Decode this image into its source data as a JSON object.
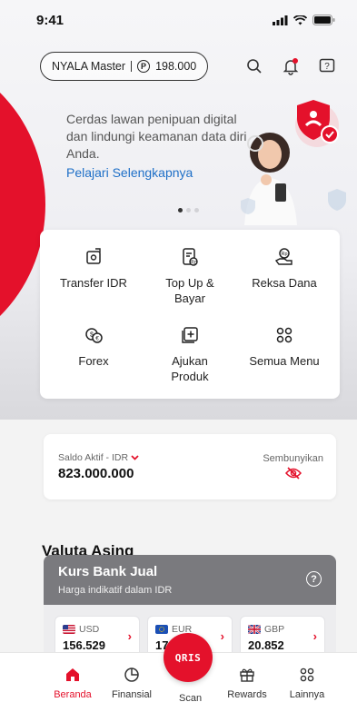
{
  "status_bar": {
    "time": "9:41"
  },
  "header": {
    "account_name": "NYALA Master",
    "points_symbol": "P",
    "points_value": "198.000"
  },
  "promo": {
    "text": "Cerdas lawan penipuan digital dan lindungi keamanan data diri Anda.",
    "link": "Pelajari Selengkapnya",
    "page_count": 3,
    "active_page": 1
  },
  "menu": {
    "items": [
      {
        "label": "Transfer IDR",
        "icon": "transfer-icon"
      },
      {
        "label": "Top Up &\nBayar",
        "icon": "topup-icon"
      },
      {
        "label": "Reksa Dana",
        "icon": "mutual-fund-icon"
      },
      {
        "label": "Forex",
        "icon": "forex-icon"
      },
      {
        "label": "Ajukan\nProduk",
        "icon": "apply-product-icon"
      },
      {
        "label": "Semua Menu",
        "icon": "all-menu-icon"
      }
    ]
  },
  "balance": {
    "label": "Saldo Aktif - IDR",
    "value": "823.000.000",
    "hide_label": "Sembunyikan"
  },
  "valuta": {
    "title": "Valuta Asing",
    "card_title": "Kurs Bank Jual",
    "card_subtitle": "Harga indikatif dalam IDR",
    "help_symbol": "?",
    "currencies": [
      {
        "code": "USD",
        "value": "156.529"
      },
      {
        "code": "EUR",
        "value": "17"
      },
      {
        "code": "GBP",
        "value": "20.852"
      }
    ]
  },
  "nav": {
    "items": [
      {
        "label": "Beranda",
        "icon": "home-icon",
        "active": true
      },
      {
        "label": "Finansial",
        "icon": "pie-chart-icon",
        "active": false
      },
      {
        "label": "Scan",
        "icon": "qris-icon",
        "active": false
      },
      {
        "label": "Rewards",
        "icon": "gift-icon",
        "active": false
      },
      {
        "label": "Lainnya",
        "icon": "grid-icon",
        "active": false
      }
    ],
    "qris_text": "QRIS"
  },
  "colors": {
    "accent": "#e4112b",
    "link": "#1e6fc7",
    "kurs_header": "#7a7a7e"
  }
}
